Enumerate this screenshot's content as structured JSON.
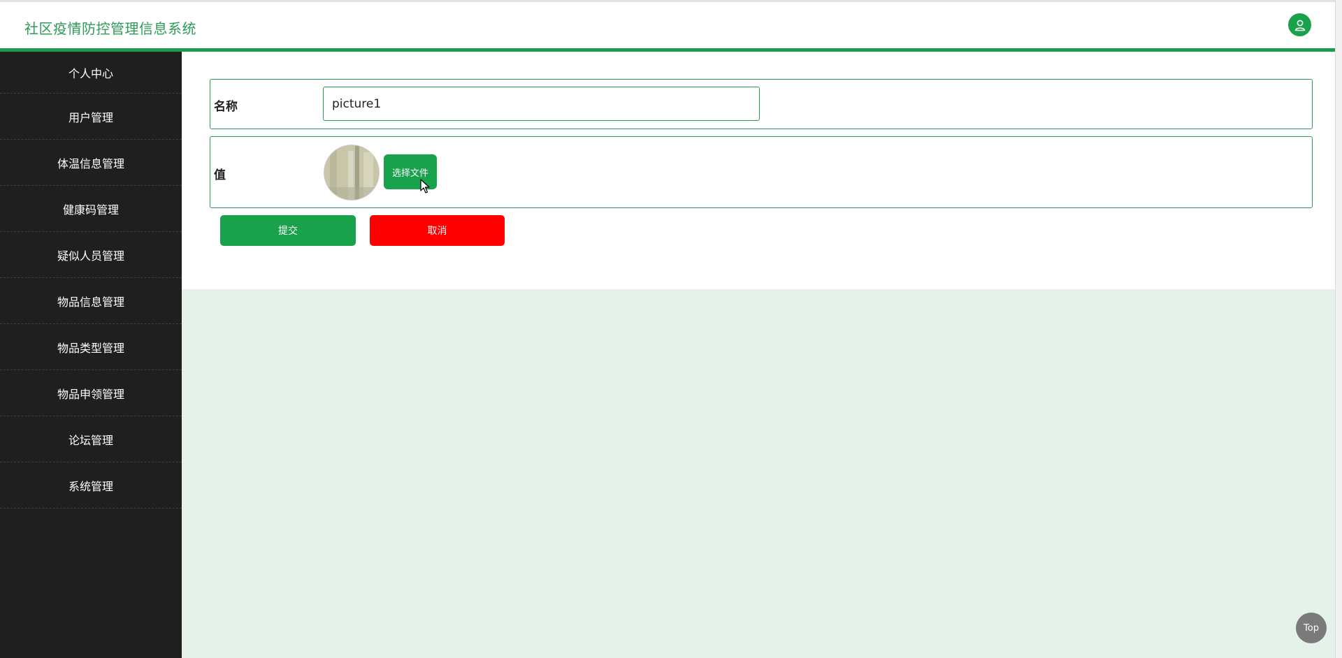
{
  "header": {
    "title": "社区疫情防控管理信息系统"
  },
  "sidebar": {
    "items": [
      {
        "label": "个人中心"
      },
      {
        "label": "用户管理"
      },
      {
        "label": "体温信息管理"
      },
      {
        "label": "健康码管理"
      },
      {
        "label": "疑似人员管理"
      },
      {
        "label": "物品信息管理"
      },
      {
        "label": "物品类型管理"
      },
      {
        "label": "物品申领管理"
      },
      {
        "label": "论坛管理"
      },
      {
        "label": "系统管理"
      }
    ]
  },
  "form": {
    "name_label": "名称",
    "name_value": "picture1",
    "value_label": "值",
    "choose_file_label": "选择文件",
    "submit_label": "提交",
    "cancel_label": "取消"
  },
  "footer": {
    "top_label": "Top"
  },
  "colors": {
    "accent": "#18a24b",
    "title_green": "#2f9a57",
    "cancel_red": "#ff0000",
    "sidebar_bg": "#1f1f1f",
    "content_tint": "#e5f2ea"
  },
  "icons": {
    "user": "user-icon",
    "cursor": "mouse-cursor-icon"
  }
}
